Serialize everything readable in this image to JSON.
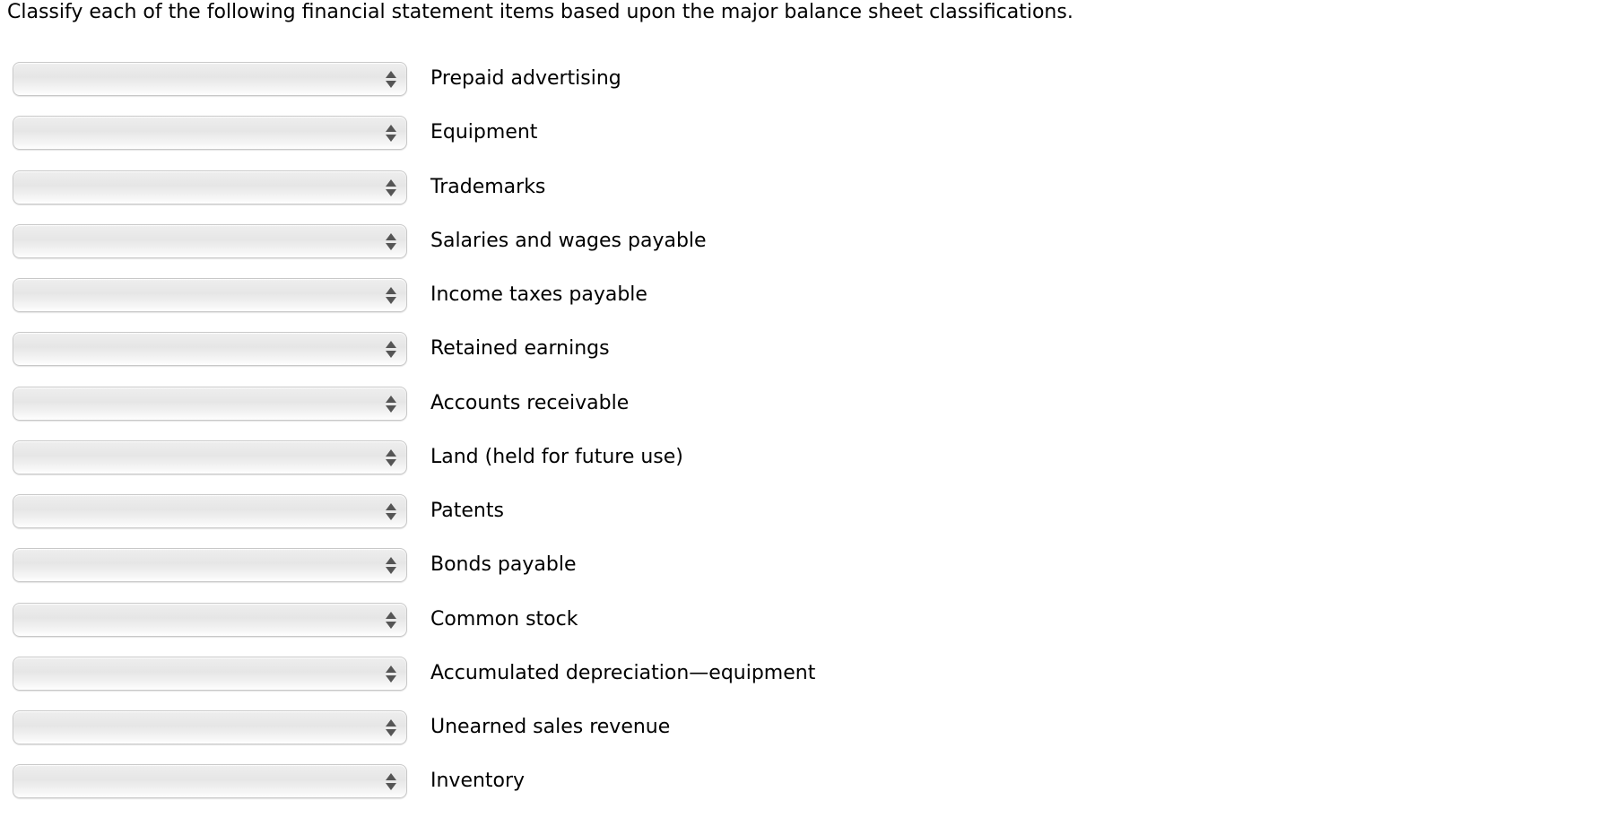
{
  "instructions": "Classify each of the following financial statement items based upon the major balance sheet classifications.",
  "items": [
    {
      "label": "Prepaid advertising",
      "selected": ""
    },
    {
      "label": "Equipment",
      "selected": ""
    },
    {
      "label": "Trademarks",
      "selected": ""
    },
    {
      "label": "Salaries and wages payable",
      "selected": ""
    },
    {
      "label": "Income taxes payable",
      "selected": ""
    },
    {
      "label": "Retained earnings",
      "selected": ""
    },
    {
      "label": "Accounts receivable",
      "selected": ""
    },
    {
      "label": "Land (held for future use)",
      "selected": ""
    },
    {
      "label": "Patents",
      "selected": ""
    },
    {
      "label": "Bonds payable",
      "selected": ""
    },
    {
      "label": "Common stock",
      "selected": ""
    },
    {
      "label": "Accumulated depreciation—equipment",
      "selected": ""
    },
    {
      "label": "Unearned sales revenue",
      "selected": ""
    },
    {
      "label": "Inventory",
      "selected": ""
    }
  ],
  "icons": {
    "dropdown": "up-down-arrows-icon"
  }
}
